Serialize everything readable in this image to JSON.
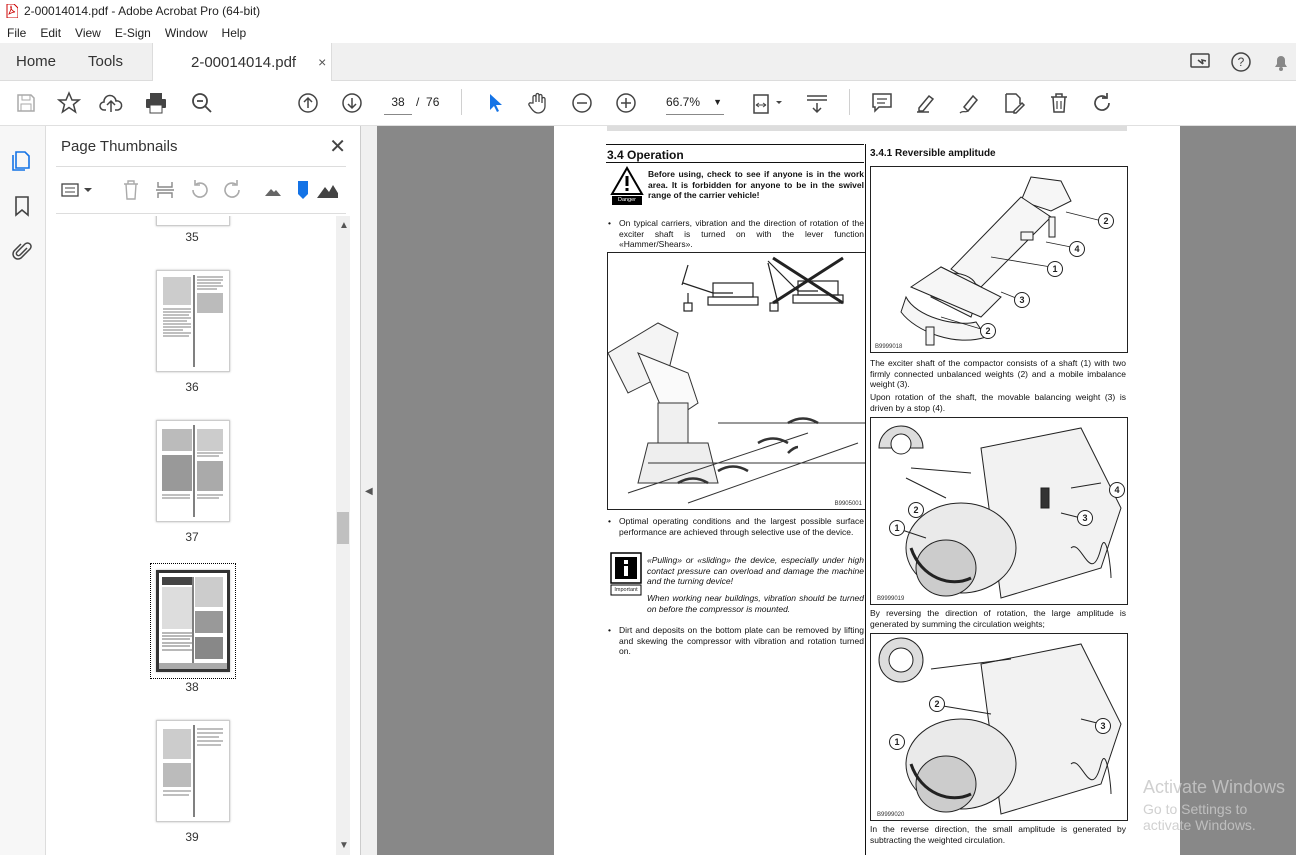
{
  "window": {
    "title": "2-00014014.pdf - Adobe Acrobat Pro (64-bit)"
  },
  "menu": [
    "File",
    "Edit",
    "View",
    "E-Sign",
    "Window",
    "Help"
  ],
  "tabs": {
    "home": "Home",
    "tools": "Tools",
    "document": "2-00014014.pdf",
    "close": "×"
  },
  "toolbar": {
    "page_current": "38",
    "page_sep": "/",
    "page_total": "76",
    "zoom": "66.7%"
  },
  "panel": {
    "title": "Page Thumbnails",
    "close": "✕"
  },
  "thumbnails": [
    {
      "label": "35"
    },
    {
      "label": "36"
    },
    {
      "label": "37"
    },
    {
      "label": "38"
    },
    {
      "label": "39"
    }
  ],
  "document": {
    "section_title": "3.4  Operation",
    "danger_text": "Before using, check to see if anyone is in the work area. It is forbidden for anyone to be in the swivel range of the carrier vehicle!",
    "danger_label": "Danger",
    "bullet1": "On typical carriers, vibration and the direction of rotation of the exciter shaft is turned on with the lever function «Hammer/Shears».",
    "fig1_code": "B9905001",
    "bullet2": "Optimal operating conditions and the largest possible surface performance are achieved through selective use of the device.",
    "important_label": "Important",
    "important_text1": "«Pulling» or «sliding» the device, especially under high contact pressure can overload and damage the machine and the turning device!",
    "important_text2": "When working near buildings, vibration should be turned on before the compressor is mounted.",
    "bullet3": "Dirt and deposits on the bottom plate can be removed by lifting and skewing the compressor with vibration and rotation turned on.",
    "subsection_title": "3.4.1  Reversible amplitude",
    "fig2_code": "B9999018",
    "para1": "The exciter shaft of the compactor consists of a shaft (1) with two firmly connected unbalanced weights (2) and a mobile imbalance weight (3).",
    "para2": "Upon rotation of the shaft, the movable balancing weight (3) is driven by a stop (4).",
    "fig3_code": "B9999019",
    "para3": "By reversing the direction of rotation, the large amplitude is generated by summing the circulation weights;",
    "fig4_code": "B9999020",
    "para4": "In the reverse direction, the small amplitude is generated by subtracting the weighted circulation.",
    "callouts": {
      "one": "1",
      "two": "2",
      "three": "3",
      "four": "4"
    }
  },
  "watermark": {
    "line1": "Activate Windows",
    "line2": "Go to Settings to activate Windows."
  }
}
